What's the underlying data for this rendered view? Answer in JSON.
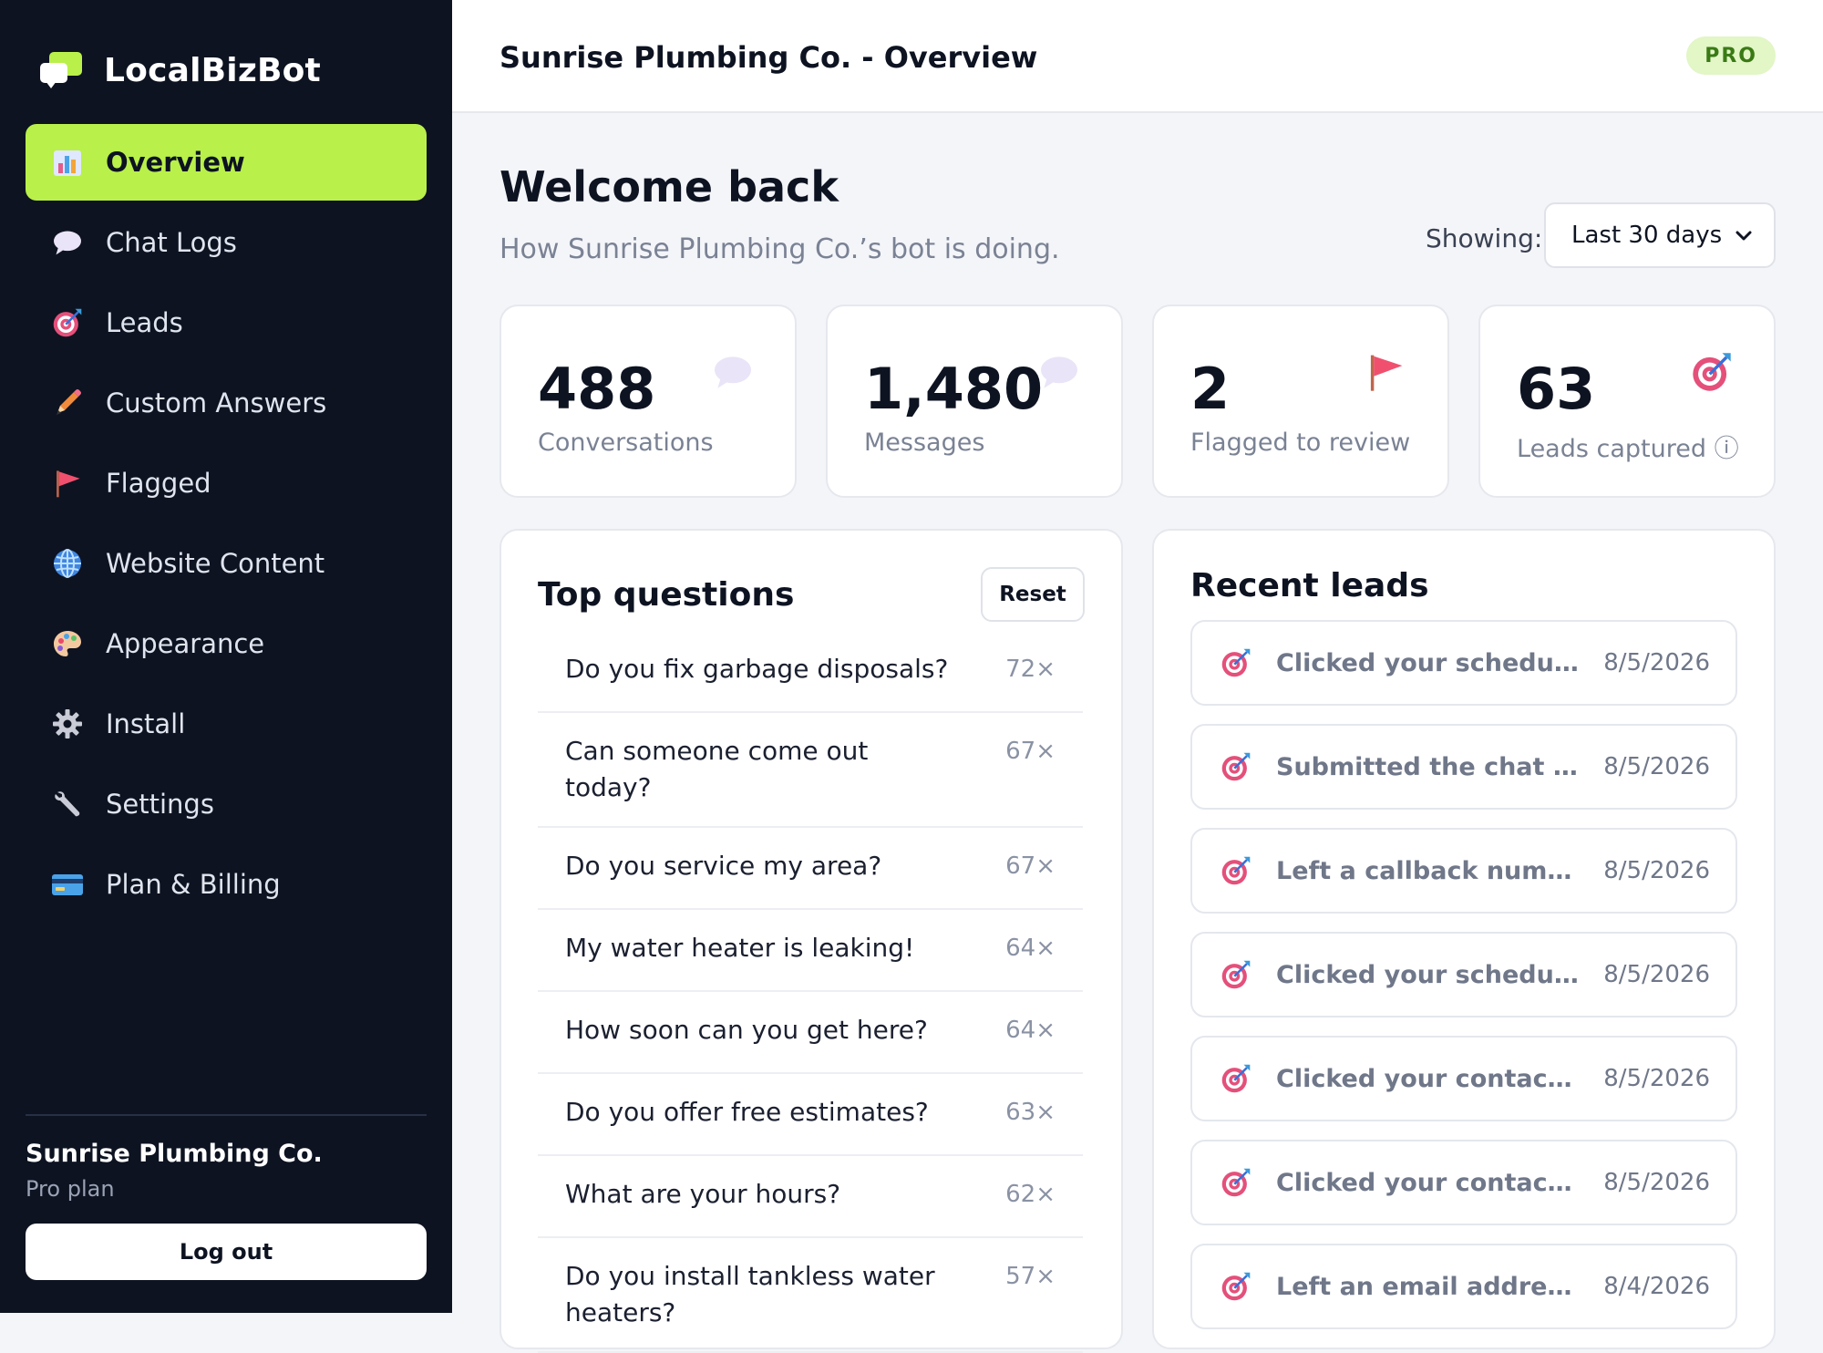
{
  "brand": {
    "name": "LocalBizBot"
  },
  "sidebar": {
    "items": [
      {
        "label": "Overview",
        "icon": "bar-chart-icon",
        "active": true
      },
      {
        "label": "Chat Logs",
        "icon": "speech-bubble-icon"
      },
      {
        "label": "Leads",
        "icon": "target-icon"
      },
      {
        "label": "Custom Answers",
        "icon": "pencil-icon"
      },
      {
        "label": "Flagged",
        "icon": "flag-icon"
      },
      {
        "label": "Website Content",
        "icon": "globe-icon"
      },
      {
        "label": "Appearance",
        "icon": "palette-icon"
      },
      {
        "label": "Install",
        "icon": "gear-icon"
      },
      {
        "label": "Settings",
        "icon": "wrench-icon"
      },
      {
        "label": "Plan & Billing",
        "icon": "credit-card-icon"
      }
    ],
    "business_name": "Sunrise Plumbing Co.",
    "plan": "Pro plan",
    "logout_label": "Log out"
  },
  "header": {
    "title": "Sunrise Plumbing Co. - Overview",
    "badge": "PRO"
  },
  "main": {
    "welcome": "Welcome back",
    "subtitle": "How Sunrise Plumbing Co.’s bot is doing.",
    "showing_label": "Showing:",
    "range_value": "Last 30 days",
    "stats": [
      {
        "value": "488",
        "label": "Conversations",
        "icon": "speech-bubble-icon"
      },
      {
        "value": "1,480",
        "label": "Messages",
        "icon": "speech-bubble-icon"
      },
      {
        "value": "2",
        "label": "Flagged to review",
        "icon": "flag-icon"
      },
      {
        "value": "63",
        "label": "Leads captured ⓘ",
        "icon": "target-icon"
      }
    ],
    "top_questions": {
      "title": "Top questions",
      "reset_label": "Reset",
      "rows": [
        {
          "q": "Do you fix garbage disposals?",
          "count": "72×"
        },
        {
          "q": "Can someone come out today?",
          "count": "67×"
        },
        {
          "q": "Do you service my area?",
          "count": "67×"
        },
        {
          "q": "My water heater is leaking!",
          "count": "64×"
        },
        {
          "q": "How soon can you get here?",
          "count": "64×"
        },
        {
          "q": "Do you offer free estimates?",
          "count": "63×"
        },
        {
          "q": "What are your hours?",
          "count": "62×"
        },
        {
          "q": "Do you install tankless water heaters?",
          "count": "57×"
        }
      ]
    },
    "recent_leads": {
      "title": "Recent leads",
      "rows": [
        {
          "text": "Clicked your scheduling…",
          "date": "8/5/2026"
        },
        {
          "text": "Submitted the chat for…",
          "date": "8/5/2026"
        },
        {
          "text": "Left a callback number …",
          "date": "8/5/2026"
        },
        {
          "text": "Clicked your scheduling…",
          "date": "8/5/2026"
        },
        {
          "text": "Clicked your contact for…",
          "date": "8/5/2026"
        },
        {
          "text": "Clicked your contact for…",
          "date": "8/5/2026"
        },
        {
          "text": "Left an email address —…",
          "date": "8/4/2026"
        }
      ]
    }
  },
  "colors": {
    "accent": "#b9f04a",
    "sidebar_bg": "#0d1321",
    "badge_bg": "#e2f6c6",
    "badge_text": "#3a7a15"
  }
}
